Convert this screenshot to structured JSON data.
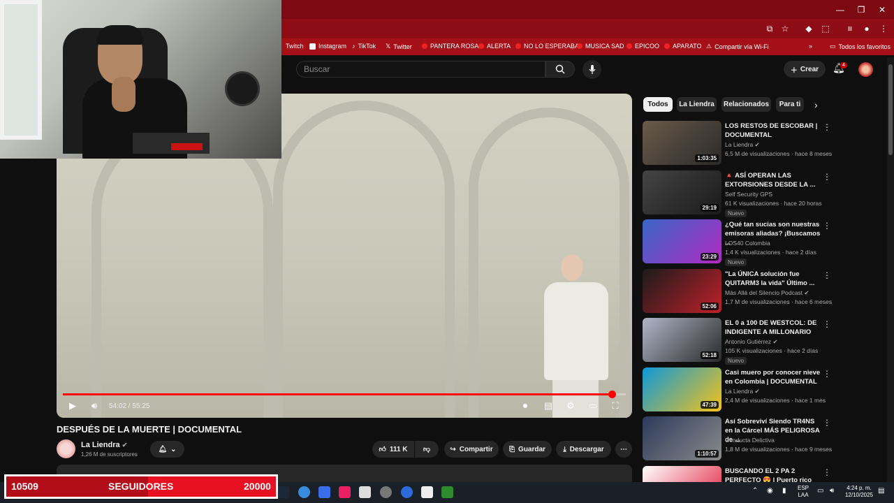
{
  "bookmarks": [
    "Twitch",
    "Instagram",
    "TikTok",
    "Twitter",
    "PANTERA ROSA",
    "ALERTA",
    "NO LO ESPERABA",
    "MUSICA SAD",
    "EPICOO",
    "APARATO",
    "Compartir vía Wi-Fi"
  ],
  "bookmarks_folder": "Todos los favoritos",
  "search": {
    "placeholder": "Buscar"
  },
  "header": {
    "create_label": "Crear",
    "notifications": "4"
  },
  "player": {
    "time": "54:02 / 55:25",
    "progress": 0.975
  },
  "video": {
    "title": "DESPUÉS DE LA MUERTE | DOCUMENTAL",
    "channel": "La Liendra",
    "subscribers": "1,26 M de suscriptores",
    "likes": "111 K",
    "share_label": "Compartir",
    "save_label": "Guardar",
    "download_label": "Descargar"
  },
  "chips": [
    "Todos",
    "La Liendra",
    "Relacionados",
    "Para ti"
  ],
  "recommendations": [
    {
      "title": "LOS RESTOS DE ESCOBAR | DOCUMENTAL",
      "channel": "La Liendra",
      "meta": "6,5 M de visualizaciones · hace 8 meses",
      "duration": "1:03:35",
      "badge": "",
      "verified": true
    },
    {
      "title": "🔺 ASÍ OPERAN LAS EXTORSIONES DESDE LA ...",
      "channel": "Self Security GPS",
      "meta": "61 K visualizaciones · hace 20 horas",
      "duration": "29:19",
      "badge": "Nuevo",
      "verified": false
    },
    {
      "title": "¿Qué tan sucias son nuestras emisoras aliadas? ¡Buscamos ...",
      "channel": "LOS40 Colombia",
      "meta": "1,4 K visualizaciones · hace 2 días",
      "duration": "23:29",
      "badge": "Nuevo",
      "verified": false
    },
    {
      "title": "\"La ÚNICA solución fue QUITARM3 la vida\" Último ...",
      "channel": "Más Allá del Silencio Podcast",
      "meta": "1,7 M de visualizaciones · hace 6 meses",
      "duration": "52:06",
      "badge": "",
      "verified": true
    },
    {
      "title": "EL 0 a 100 DE WESTCOL: DE INDIGENTE A MILLONARIO",
      "channel": "Antonio Gutiérrez",
      "meta": "105 K visualizaciones · hace 2 días",
      "duration": "52:18",
      "badge": "Nuevo",
      "verified": true
    },
    {
      "title": "Casi muero por conocer nieve en Colombia | DOCUMENTAL",
      "channel": "La Liendra",
      "meta": "2,4 M de visualizaciones · hace 1 mes",
      "duration": "47:39",
      "badge": "",
      "verified": true
    },
    {
      "title": "Así Sobreviví Siendo TR4NS en la Cárcel MÁS PELIGROSA de ...",
      "channel": "Conducta Delictiva",
      "meta": "1,8 M de visualizaciones · hace 9 meses",
      "duration": "1:10:57",
      "badge": "",
      "verified": false
    },
    {
      "title": "BUSCANDO EL 2 PA 2 PERFECTO 😍 | Puerto rico",
      "channel": "",
      "meta": "",
      "duration": "",
      "badge": "",
      "verified": false
    }
  ],
  "followers": {
    "current": "10509",
    "label": "SEGUIDORES",
    "goal": "20000",
    "progress": 0.5255
  },
  "tray": {
    "lang": "ESP",
    "lang2": "LAA",
    "time": "4:24 p. m.",
    "date": "12/10/2025"
  }
}
